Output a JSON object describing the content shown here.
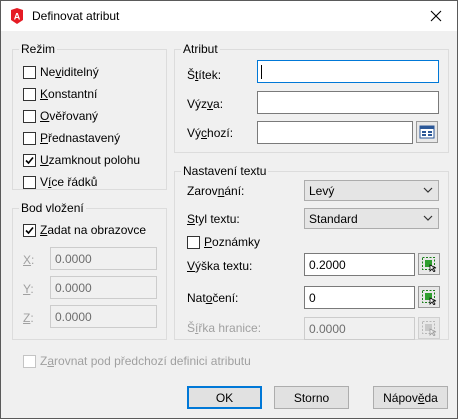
{
  "window": {
    "title": "Definovat atribut",
    "app_icon_letter": "A",
    "accent_color": "#e51b24"
  },
  "mode": {
    "title": "Režim",
    "items": [
      {
        "pre": "Ne",
        "key": "v",
        "post": "iditelný",
        "checked": false
      },
      {
        "pre": "",
        "key": "K",
        "post": "onstantní",
        "checked": false
      },
      {
        "pre": "",
        "key": "O",
        "post": "věřovaný",
        "checked": false
      },
      {
        "pre": "",
        "key": "P",
        "post": "řednastavený",
        "checked": false
      },
      {
        "pre": "",
        "key": "U",
        "post": "zamknout polohu",
        "checked": true
      },
      {
        "pre": "V",
        "key": "í",
        "post": "ce řádků",
        "checked": false
      }
    ]
  },
  "attribute": {
    "title": "Atribut",
    "tag": {
      "pre": "Š",
      "key": "t",
      "post": "ítek:",
      "value": ""
    },
    "prompt": {
      "pre": "Výz",
      "key": "v",
      "post": "a:",
      "value": ""
    },
    "default": {
      "pre": "Vý",
      "key": "c",
      "post": "hozí:",
      "value": ""
    }
  },
  "insert_point": {
    "title": "Bod vložení",
    "specify_on_screen": {
      "pre": "",
      "key": "Z",
      "post": "adat na obrazovce",
      "checked": true
    },
    "x": {
      "key": "X",
      "post": ":",
      "value": "0.0000"
    },
    "y": {
      "key": "Y",
      "post": ":",
      "value": "0.0000"
    },
    "z": {
      "key": "Z",
      "post": ":",
      "value": "0.0000"
    }
  },
  "text_settings": {
    "title": "Nastavení textu",
    "justification": {
      "pre": "Zarov",
      "key": "n",
      "post": "ání:",
      "value": "Levý"
    },
    "text_style": {
      "pre": "",
      "key": "S",
      "post": "tyl textu:",
      "value": "Standard"
    },
    "annotative": {
      "pre": "",
      "key": "P",
      "post": "oznámky",
      "checked": false
    },
    "text_height": {
      "pre": "",
      "key": "V",
      "post": "ýška textu:",
      "value": "0.2000"
    },
    "rotation": {
      "pre": "Nat",
      "key": "o",
      "post": "čení:",
      "value": "0"
    },
    "boundary_width": {
      "pre": "Š",
      "key": "í",
      "post": "řka hranice:",
      "value": "0.0000"
    }
  },
  "align_below": {
    "pre": "Z",
    "key": "a",
    "post": "rovnat pod předchozí definici atributu",
    "checked": false
  },
  "buttons": {
    "ok": "OK",
    "cancel": "Storno",
    "help_pre": "Nápov",
    "help_key": "ě",
    "help_post": "da"
  }
}
